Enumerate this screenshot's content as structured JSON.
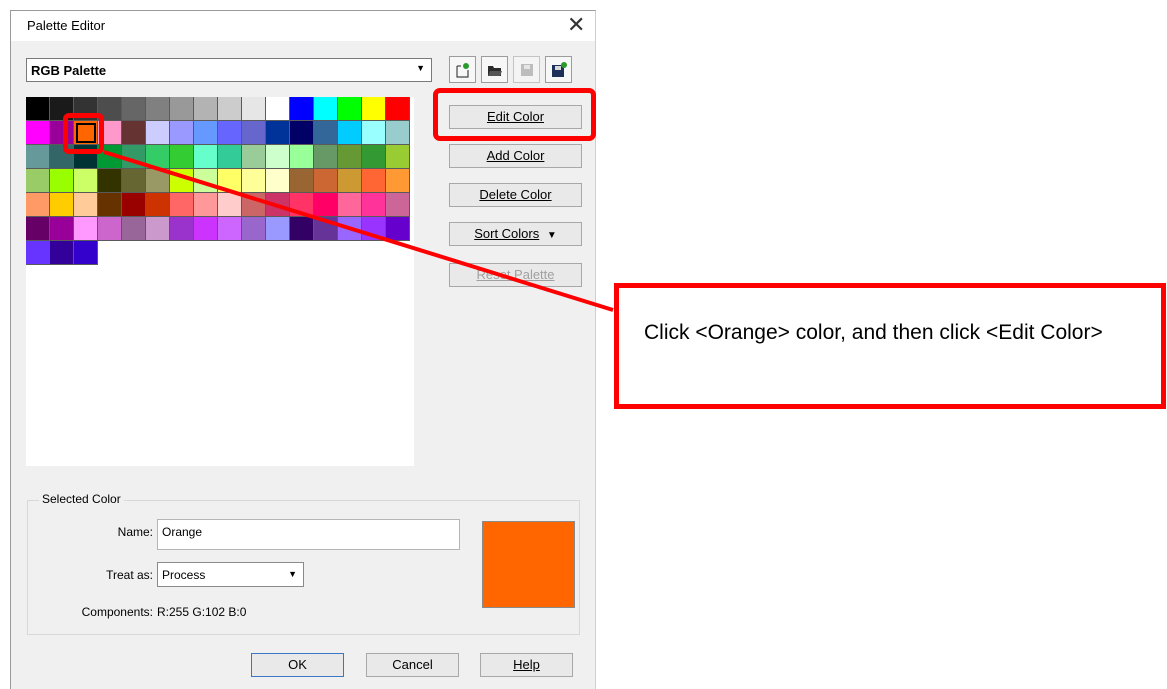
{
  "dialog": {
    "title": "Palette Editor",
    "close_glyph": "✕",
    "palette_select": {
      "value": "RGB Palette",
      "arrow": "▼"
    },
    "toolbar_icons": [
      "new-palette-icon",
      "open-palette-icon",
      "save-palette-icon",
      "save-as-palette-icon"
    ],
    "buttons": {
      "edit_color": "Edit Color",
      "add_color": "Add Color",
      "delete_color": "Delete Color",
      "sort_colors": "Sort Colors",
      "sort_arrow": "▼",
      "reset_palette": "Reset Palette"
    },
    "swatches": [
      "#000000",
      "#1a1a1a",
      "#333333",
      "#4d4d4d",
      "#666666",
      "#808080",
      "#999999",
      "#b3b3b3",
      "#cccccc",
      "#e6e6e6",
      "#ffffff",
      "#0000ff",
      "#00ffff",
      "#00ff00",
      "#ffff00",
      "#ff0000",
      "#ff00ff",
      "#990099",
      "#ff6600",
      "#ff99cc",
      "#663333",
      "#ccccff",
      "#9999ff",
      "#6699ff",
      "#6666ff",
      "#6666cc",
      "#003399",
      "#000066",
      "#336699",
      "#00ccff",
      "#99ffff",
      "#99cccc",
      "#669999",
      "#336666",
      "#003333",
      "#009933",
      "#339966",
      "#33cc66",
      "#33cc33",
      "#66ffcc",
      "#33cc99",
      "#99cc99",
      "#ccffcc",
      "#99ff99",
      "#669966",
      "#669933",
      "#339933",
      "#99cc33",
      "#99cc66",
      "#99ff00",
      "#ccff66",
      "#333300",
      "#666633",
      "#999966",
      "#ccff00",
      "#ccff99",
      "#ffff66",
      "#ffff99",
      "#ffffcc",
      "#996633",
      "#cc6633",
      "#cc9933",
      "#ff6633",
      "#ff9933",
      "#ff9966",
      "#ffcc00",
      "#ffcc99",
      "#663300",
      "#990000",
      "#cc3300",
      "#ff6666",
      "#ff9999",
      "#ffcccc",
      "#cc6666",
      "#cc3366",
      "#ff3366",
      "#ff0066",
      "#ff6699",
      "#ff3399",
      "#cc6699",
      "#660066",
      "#990099",
      "#ff99ff",
      "#cc66cc",
      "#996699",
      "#cc99cc",
      "#9933cc",
      "#cc33ff",
      "#cc66ff",
      "#9966cc",
      "#9999ff",
      "#330066",
      "#663399",
      "#9966ff",
      "#9933ff",
      "#6600cc",
      "#6633ff",
      "#330099",
      "#3300cc"
    ],
    "selected_index": 18,
    "selected_color": {
      "group_label": "Selected Color",
      "name_label": "Name:",
      "name_value": "Orange",
      "treat_label": "Treat as:",
      "treat_value": "Process",
      "components_label": "Components:",
      "components_value": "R:255 G:102 B:0",
      "preview_color": "#ff6600"
    },
    "footer": {
      "ok": "OK",
      "cancel": "Cancel",
      "help": "Help"
    }
  },
  "annotation": {
    "text": "Click <Orange> color, and then click <Edit Color>",
    "color": "#ff0000"
  }
}
